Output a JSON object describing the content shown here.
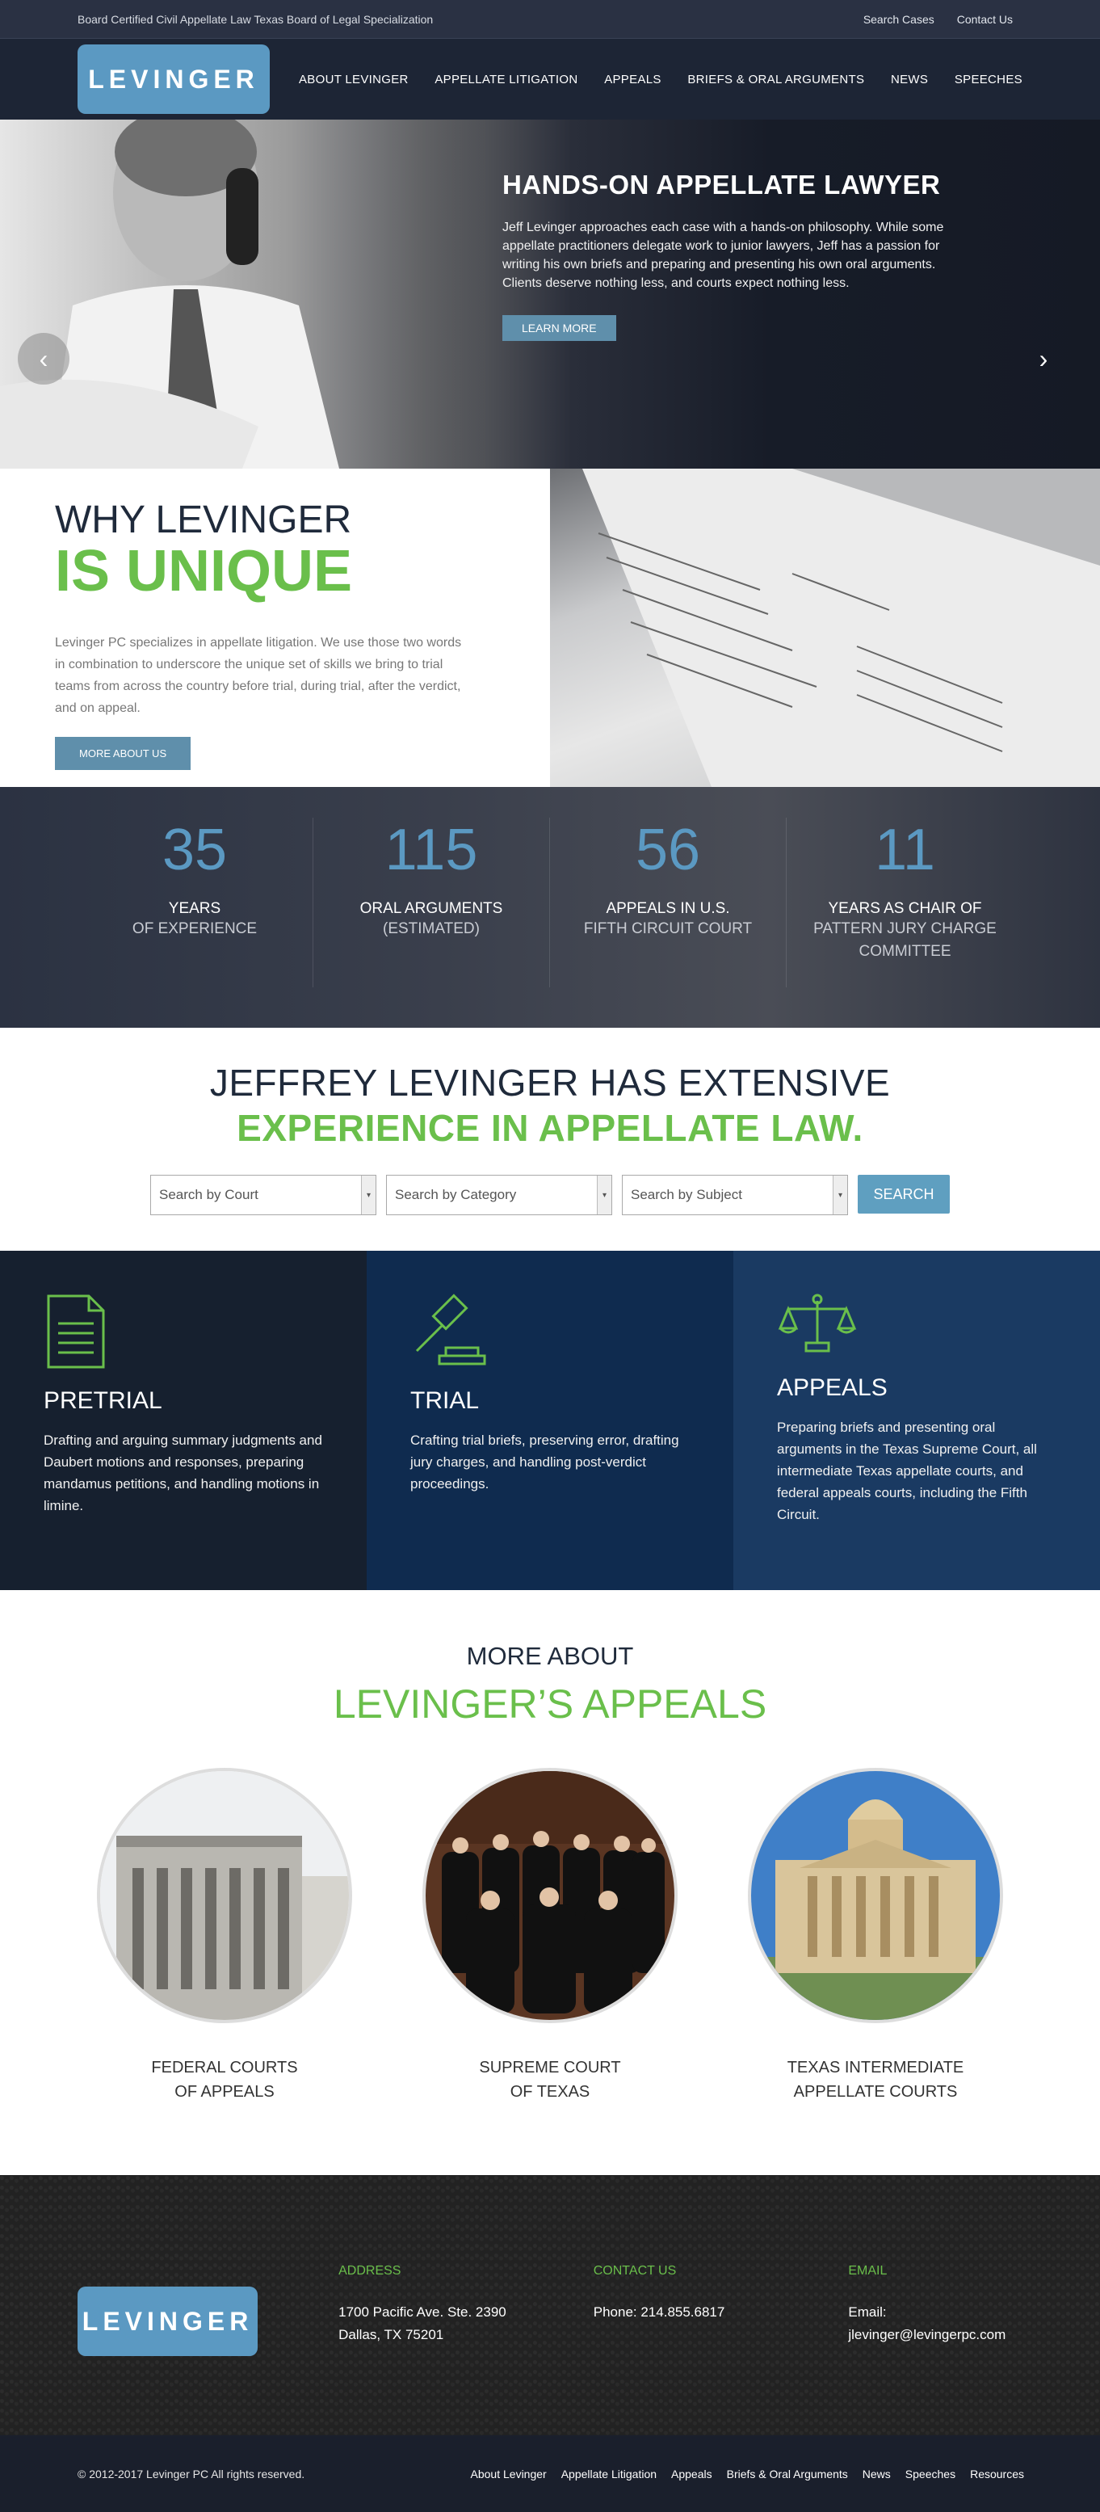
{
  "topbar": {
    "cert_text": "Board Certified Civil Appellate Law Texas Board of Legal Specialization",
    "links": [
      "Search Cases",
      "Contact Us"
    ]
  },
  "nav": {
    "logo_text": "LEVINGER",
    "items": [
      "ABOUT LEVINGER",
      "APPELLATE LITIGATION",
      "APPEALS",
      "BRIEFS & ORAL ARGUMENTS",
      "NEWS",
      "SPEECHES"
    ]
  },
  "hero": {
    "title": "HANDS-ON APPELLATE LAWYER",
    "body": "Jeff Levinger approaches each case with a hands-on philosophy. While some appellate practitioners delegate work to junior lawyers, Jeff has a passion for writing his own briefs and preparing and presenting his own oral arguments. Clients deserve nothing less, and courts expect nothing less.",
    "button": "LEARN MORE",
    "arrow_left": "‹",
    "arrow_right": "›"
  },
  "why": {
    "title_line1": "WHY LEVINGER",
    "title_line2": "IS UNIQUE",
    "body": "Levinger PC specializes in appellate litigation. We use those two words in combination to underscore the unique set of skills we bring to trial teams from across the country before trial, during trial, after the verdict, and on appeal.",
    "button": "MORE ABOUT US"
  },
  "stats": [
    {
      "num": "35",
      "l1": "YEARS",
      "l2": "OF EXPERIENCE"
    },
    {
      "num": "115",
      "l1": "ORAL ARGUMENTS",
      "l2": "(ESTIMATED)"
    },
    {
      "num": "56",
      "l1": "APPEALS IN U.S.",
      "l2": "FIFTH CIRCUIT COURT"
    },
    {
      "num": "11",
      "l1": "YEARS AS CHAIR OF",
      "l2": "PATTERN JURY CHARGE COMMITTEE"
    }
  ],
  "experience": {
    "line1": "JEFFREY LEVINGER HAS EXTENSIVE",
    "line2": "EXPERIENCE IN APPELLATE LAW.",
    "search_court": "Search by Court",
    "search_category": "Search by Category",
    "search_subject": "Search by Subject",
    "search_button": "SEARCH"
  },
  "services": [
    {
      "title": "PRETRIAL",
      "body": "Drafting and arguing summary judgments and Daubert motions and responses, preparing mandamus petitions, and handling motions in limine."
    },
    {
      "title": "TRIAL",
      "body": "Crafting trial briefs, preserving error, drafting jury charges, and handling post-verdict proceedings."
    },
    {
      "title": "APPEALS",
      "body": "Preparing briefs and presenting oral arguments in the Texas Supreme Court, all intermediate Texas appellate courts, and federal appeals courts, including the Fifth Circuit."
    }
  ],
  "more": {
    "t1": "MORE ABOUT",
    "t2": "LEVINGER’S APPEALS",
    "courts": [
      {
        "l1": "FEDERAL COURTS",
        "l2": "OF APPEALS"
      },
      {
        "l1": "SUPREME COURT",
        "l2": "OF TEXAS"
      },
      {
        "l1": "TEXAS INTERMEDIATE",
        "l2": "APPELLATE COURTS"
      }
    ]
  },
  "footer": {
    "logo_text": "LEVINGER",
    "address_h": "ADDRESS",
    "address_1": "1700 Pacific Ave. Ste. 2390",
    "address_2": "Dallas, TX 75201",
    "contact_h": "CONTACT US",
    "phone": "Phone: 214.855.6817",
    "email_h": "EMAIL",
    "email_1": "Email:",
    "email_2": "jlevinger@levingerpc.com",
    "copyright": "© 2012-2017 Levinger PC All rights reserved.",
    "links": [
      "About Levinger",
      "Appellate Litigation",
      "Appeals",
      "Briefs & Oral Arguments",
      "News",
      "Speeches",
      "Resources"
    ]
  }
}
